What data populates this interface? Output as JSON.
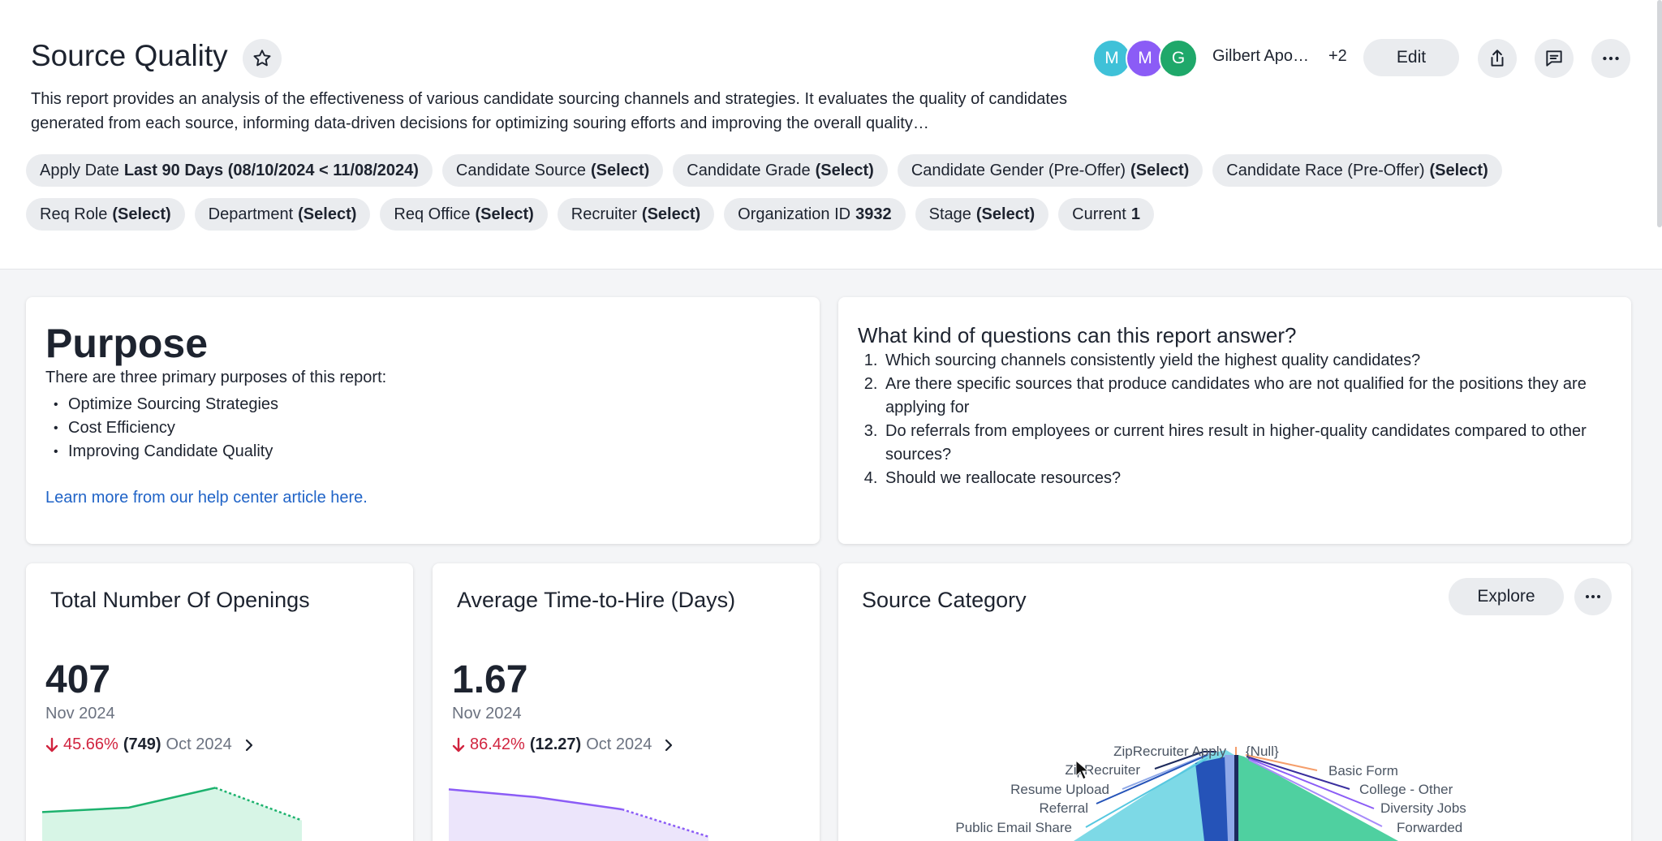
{
  "header": {
    "title": "Source Quality",
    "description": "This report provides an analysis of the effectiveness of various candidate sourcing channels and strategies. It evaluates the quality of candidates generated from each source, informing data-driven decisions for optimizing souring efforts and improving the overall quality…",
    "avatars": [
      {
        "letter": "M",
        "color": "#3fc1d8"
      },
      {
        "letter": "M",
        "color": "#8b5cf6"
      },
      {
        "letter": "G",
        "color": "#1fa86a"
      }
    ],
    "owner_name": "Gilbert Apo…",
    "owner_more": "+2",
    "edit_label": "Edit",
    "icons": [
      "star-icon",
      "share-icon",
      "comment-icon",
      "more-icon"
    ]
  },
  "filters": {
    "row1": [
      {
        "label": "Apply Date",
        "value": "Last 90 Days (08/10/2024 < 11/08/2024)"
      },
      {
        "label": "Candidate Source",
        "value": "(Select)"
      },
      {
        "label": "Candidate Grade",
        "value": "(Select)"
      },
      {
        "label": "Candidate Gender (Pre-Offer)",
        "value": "(Select)"
      },
      {
        "label": "Candidate Race (Pre-Offer)",
        "value": "(Select)"
      }
    ],
    "row2": [
      {
        "label": "Req Role",
        "value": "(Select)"
      },
      {
        "label": "Department",
        "value": "(Select)"
      },
      {
        "label": "Req Office",
        "value": "(Select)"
      },
      {
        "label": "Recruiter",
        "value": "(Select)"
      },
      {
        "label": "Organization ID",
        "value": "3932"
      },
      {
        "label": "Stage",
        "value": "(Select)"
      },
      {
        "label": "Current",
        "value": "1"
      }
    ]
  },
  "purpose": {
    "heading": "Purpose",
    "intro": "There are three primary purposes of this report:",
    "items": [
      "Optimize Sourcing Strategies",
      "Cost Efficiency",
      "Improving Candidate Quality"
    ],
    "link": "Learn more from our help center article here."
  },
  "questions": {
    "heading": "What kind of questions can this report answer?",
    "items": [
      "Which sourcing channels consistently yield the highest quality candidates?",
      "Are there specific sources that produce candidates who are not qualified for the positions they are applying for",
      "Do referrals from employees or current hires result in higher-quality candidates compared to other sources?",
      "Should we reallocate resources?"
    ]
  },
  "kpis": [
    {
      "title": "Total Number Of Openings",
      "value": "407",
      "period": "Nov 2024",
      "change_pct": "45.66%",
      "change_prev": "(749)",
      "change_period": "Oct 2024",
      "color": "#1db26e",
      "fill": "#d7f5e6",
      "trend": [
        407,
        470,
        749,
        290
      ],
      "trend_max": 800
    },
    {
      "title": "Average Time-to-Hire (Days)",
      "value": "1.67",
      "period": "Nov 2024",
      "change_pct": "86.42%",
      "change_prev": "(12.27)",
      "change_period": "Oct 2024",
      "color": "#8b5cf6",
      "fill": "#ece5fb",
      "trend": [
        20,
        17,
        12.27,
        1.67
      ],
      "trend_max": 22
    }
  ],
  "source_category": {
    "title": "Source Category",
    "explore_label": "Explore",
    "labels_left": [
      "ZipRecruiter Apply",
      "ZipRecruiter",
      "Resume Upload",
      "Referral",
      "Public Email Share"
    ],
    "labels_right": [
      "{Null}",
      "Basic Form",
      "College - Other",
      "Diversity Jobs",
      "Forwarded"
    ]
  },
  "colors": {
    "accent_red": "#d1243f",
    "link_blue": "#1f63c7",
    "chip_bg": "#eaecef"
  }
}
